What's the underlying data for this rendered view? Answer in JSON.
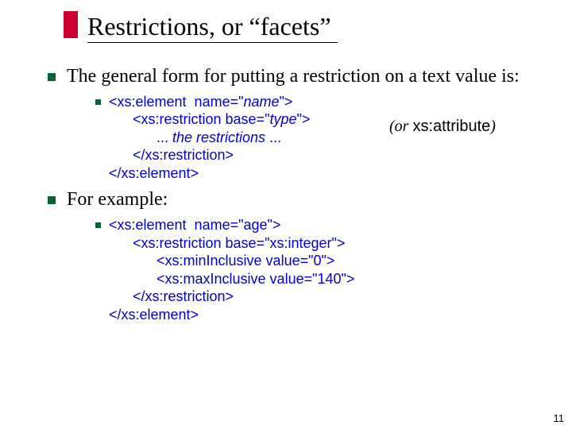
{
  "title": "Restrictions, or “facets”",
  "bullets": {
    "b1": "The general form for putting a restriction on a text value is:",
    "b2": "For example:"
  },
  "code1": {
    "l1": "<xs:element  name=\"",
    "l1name": "name",
    "l1end": "\">",
    "l2a": "      <xs:restriction base=\"",
    "l2type": "type",
    "l2b": "\">",
    "l3a": "            ... ",
    "l3b": "the restrictions",
    "l3c": " ...",
    "l4": "      </xs:restriction>",
    "l5": "</xs:element>"
  },
  "sidenote": {
    "open": "(or ",
    "word": "xs:attribute",
    "close": ")"
  },
  "code2": {
    "l1": "<xs:element  name=\"age\">",
    "l2": "      <xs:restriction base=\"xs:integer\">",
    "l3": "            <xs:minInclusive value=\"0\">",
    "l4": "            <xs:maxInclusive value=\"140\">",
    "l5": "      </xs:restriction>",
    "l6": "</xs:element>"
  },
  "page": "11"
}
